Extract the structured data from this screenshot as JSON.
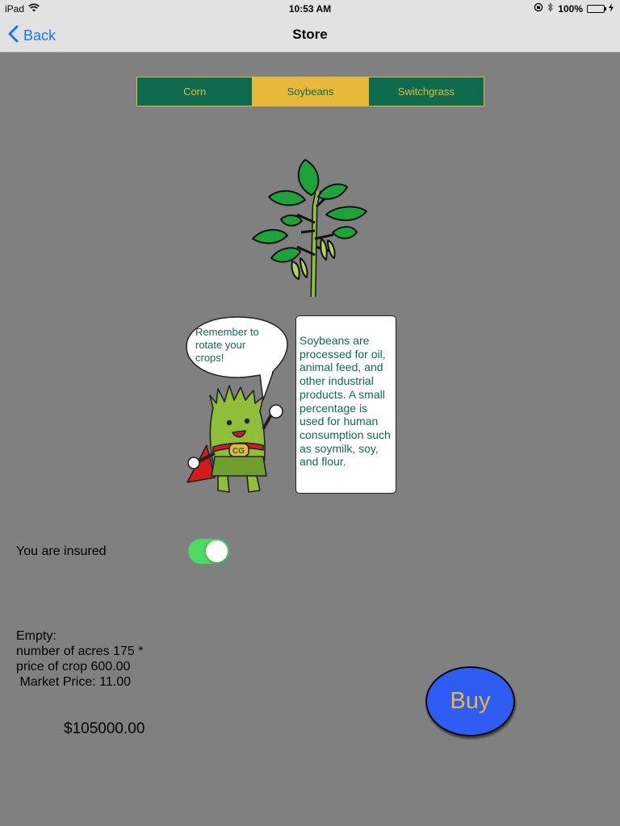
{
  "status_bar": {
    "device": "iPad",
    "time": "10:53 AM",
    "battery": "100%",
    "battery_level": 1.0
  },
  "nav": {
    "back_label": "Back",
    "title": "Store"
  },
  "tabs": [
    {
      "label": "Corn",
      "selected": false
    },
    {
      "label": "Soybeans",
      "selected": true
    },
    {
      "label": "Switchgrass",
      "selected": false
    }
  ],
  "mascot": {
    "speech": "Remember to rotate your crops!"
  },
  "info": {
    "text": "Soybeans are processed for oil, animal feed, and other industrial products. A small percentage is used for human consumption such as soymilk, soy, and flour."
  },
  "insurance": {
    "label": "You are insured",
    "enabled": true
  },
  "calculation": {
    "line1": "Empty:",
    "line2": "number of acres 175 *",
    "line3": "price of crop 600.00",
    "line4": " Market Price: 11.00",
    "total": "$105000.00"
  },
  "buy_label": "Buy",
  "colors": {
    "background": "#808080",
    "tab_green": "#0e6b4e",
    "tab_gold": "#e8b83a",
    "buy_blue": "#2f5cf2",
    "toggle_green": "#4cd964",
    "ios_blue": "#1577f0"
  }
}
